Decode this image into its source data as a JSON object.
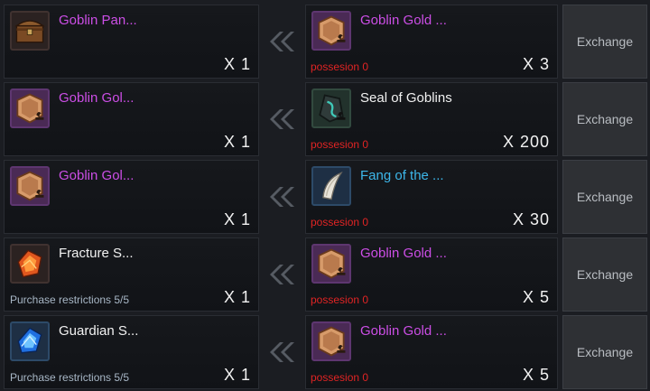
{
  "rows": [
    {
      "give": {
        "name": "Goblin Pan...",
        "qty": "X 1",
        "restriction": "",
        "icon": "treasure-chest-icon"
      },
      "receive": {
        "name": "Goblin Gold ...",
        "qty": "X 3",
        "possession": "possesion 0",
        "icon": "goblin-gold-coin-icon"
      },
      "exchange_label": "Exchange"
    },
    {
      "give": {
        "name": "Goblin Gol...",
        "qty": "X 1",
        "restriction": "",
        "icon": "goblin-gold-coin-icon"
      },
      "receive": {
        "name": "Seal of Goblins",
        "qty": "X 200",
        "possession": "possesion 0",
        "icon": "goblin-seal-icon"
      },
      "exchange_label": "Exchange"
    },
    {
      "give": {
        "name": "Goblin Gol...",
        "qty": "X 1",
        "restriction": "",
        "icon": "goblin-gold-coin-icon"
      },
      "receive": {
        "name": "Fang of the ...",
        "qty": "X 30",
        "possession": "possesion 0",
        "icon": "fang-icon"
      },
      "exchange_label": "Exchange"
    },
    {
      "give": {
        "name": "Fracture S...",
        "qty": "X 1",
        "restriction": "Purchase restrictions 5/5",
        "icon": "fracture-stone-icon"
      },
      "receive": {
        "name": "Goblin Gold ...",
        "qty": "X 5",
        "possession": "possesion 0",
        "icon": "goblin-gold-coin-icon"
      },
      "exchange_label": "Exchange"
    },
    {
      "give": {
        "name": "Guardian S...",
        "qty": "X 1",
        "restriction": "Purchase restrictions 5/5",
        "icon": "guardian-stone-icon"
      },
      "receive": {
        "name": "Goblin Gold ...",
        "qty": "X 5",
        "possession": "possesion 0",
        "icon": "goblin-gold-coin-icon"
      },
      "exchange_label": "Exchange"
    }
  ],
  "colors": {
    "legendary_name": "#cc4ee6",
    "normal_name": "#f1f1f1",
    "rare_name": "#3db7ea",
    "possession": "#e02424",
    "restriction": "#a8b7c6"
  }
}
